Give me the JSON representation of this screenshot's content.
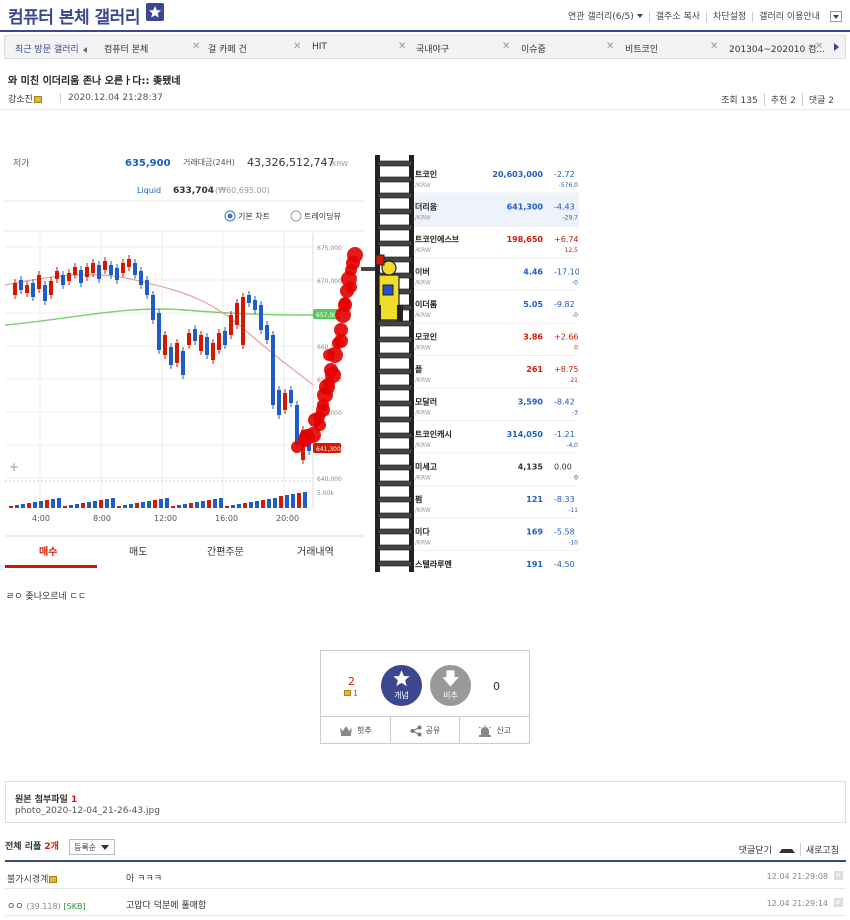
{
  "header": {
    "gallery_title": "컴퓨터 본체 갤러리",
    "links": [
      "연관 갤러리(6/5)",
      "갤주소 복사",
      "차단설정",
      "갤러리 이용안내"
    ]
  },
  "visited_tabs": {
    "label": "최근 방문 갤러리",
    "items": [
      "컴퓨터 본체",
      "걸 카페 건",
      "HIT",
      "국내야구",
      "이슈줌",
      "비트코인",
      "201304~202010 컴..."
    ]
  },
  "post": {
    "title": "와 미친 이더리움 존나 오른ㅏ다:: 좆됐네",
    "author": "강소진",
    "date": "2020.12.04 21:28:37",
    "views": "조회 135",
    "recommends": "추천 2",
    "comments": "댓글 2",
    "body_text": "ㄹㅇ 좆나오르네 ㄷㄷ"
  },
  "screenshot": {
    "price_label": "저가",
    "price": "635,900",
    "volume_label": "거래대금(24H)",
    "volume": "43,326,512,747",
    "volume_unit": "KRW",
    "liquid_label": "Liquid",
    "liquid": "633,704",
    "liquid_sub": "(₩60,695.00)",
    "chart_mode_1": "기본 차트",
    "chart_mode_2": "트레이딩뷰",
    "y_ticks": [
      "675,000",
      "670,000",
      "665,000",
      "660,000",
      "655,000",
      "650,000",
      "645,000",
      "640,000"
    ],
    "x_ticks": [
      "4:00",
      "8:00",
      "12:00",
      "16:00",
      "20:00"
    ],
    "volume_tick": "5.00k",
    "green_tag": "657,000",
    "red_tag": "641,300",
    "order_tabs": [
      "매수",
      "매도",
      "간편주문",
      "거래내역"
    ],
    "coins": [
      {
        "name": "트코인",
        "sub": "/KRW",
        "price": "20,603,000",
        "change": "-2.72",
        "sub_change": "-576,0",
        "price_color": "#1e5cc8",
        "change_color": "#1e5cc8"
      },
      {
        "name": "더리움",
        "sub": "/KRW",
        "price": "641,300",
        "change": "-4.43",
        "sub_change": "-29,7",
        "price_color": "#1e5cc8",
        "change_color": "#1e5cc8"
      },
      {
        "name": "트코인에스브",
        "sub": "/KRW",
        "price": "198,650",
        "change": "+6.74",
        "sub_change": "12,5",
        "price_color": "#d31900",
        "change_color": "#d31900"
      },
      {
        "name": "이버",
        "sub": "/KRW",
        "price": "4.46",
        "change": "-17.10",
        "sub_change": "-0",
        "price_color": "#1e5cc8",
        "change_color": "#1e5cc8"
      },
      {
        "name": "이더롬",
        "sub": "/KRW",
        "price": "5.05",
        "change": "-9.82",
        "sub_change": "-0",
        "price_color": "#1e5cc8",
        "change_color": "#1e5cc8"
      },
      {
        "name": "모코인",
        "sub": "/KRW",
        "price": "3.86",
        "change": "+2.66",
        "sub_change": "0",
        "price_color": "#d31900",
        "change_color": "#d31900"
      },
      {
        "name": "플",
        "sub": "/KRW",
        "price": "261",
        "change": "+8.75",
        "sub_change": "21",
        "price_color": "#d31900",
        "change_color": "#d31900"
      },
      {
        "name": "모달러",
        "sub": "/KRW",
        "price": "3,590",
        "change": "-8.42",
        "sub_change": "-3",
        "price_color": "#1e5cc8",
        "change_color": "#1e5cc8"
      },
      {
        "name": "트코인캐시",
        "sub": "/KRW",
        "price": "314,050",
        "change": "-1.21",
        "sub_change": "-4,0",
        "price_color": "#1e5cc8",
        "change_color": "#1e5cc8"
      },
      {
        "name": "미세고",
        "sub": "/KRW",
        "price": "4,135",
        "change": "0.00",
        "sub_change": "0",
        "price_color": "#333333",
        "change_color": "#333333"
      },
      {
        "name": "펌",
        "sub": "/KRW",
        "price": "121",
        "change": "-8.33",
        "sub_change": "-11",
        "price_color": "#1e5cc8",
        "change_color": "#1e5cc8"
      },
      {
        "name": "미다",
        "sub": "/KRW",
        "price": "169",
        "change": "-5.58",
        "sub_change": "-10",
        "price_color": "#1e5cc8",
        "change_color": "#1e5cc8"
      },
      {
        "name": "스텔라루멘",
        "sub": "/KRW",
        "price": "191",
        "change": "-4.50",
        "sub_change": "",
        "price_color": "#1e5cc8",
        "change_color": "#1e5cc8"
      }
    ]
  },
  "recommend": {
    "up_count": "2",
    "fix_count": "1",
    "up_label": "개념",
    "down_label": "비추",
    "down_count": "0",
    "actions": [
      "힛추",
      "공유",
      "신고"
    ]
  },
  "attachment": {
    "label": "원본 첨부파일",
    "count": "1",
    "filename": "photo_2020-12-04_21-26-43.jpg"
  },
  "comments": {
    "label": "전체 리플",
    "count": "2개",
    "sort": "등록순",
    "close_label": "댓글닫기",
    "refresh_label": "새로고침",
    "items": [
      {
        "nick": "불가시경계",
        "ip": "",
        "tag": "",
        "text": "아 ㅋㅋㅋ",
        "time": "12.04 21:29:08"
      },
      {
        "nick": "ㅇㅇ",
        "ip": "(39.118)",
        "tag": "[SKB]",
        "text": "고맙다 덕분에 풀매함",
        "time": "12.04 21:29:14"
      }
    ]
  },
  "colors": {
    "brand": "#3b4890",
    "up_red": "#d31900",
    "down_blue": "#1e5cc8"
  }
}
